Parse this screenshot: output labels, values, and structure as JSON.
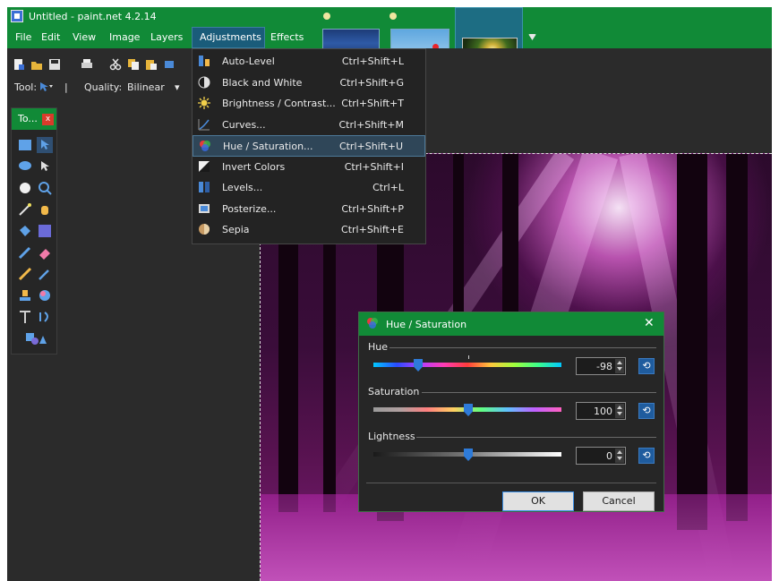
{
  "window": {
    "title": "Untitled - paint.net 4.2.14"
  },
  "menubar": {
    "items": [
      "File",
      "Edit",
      "View",
      "Image",
      "Layers",
      "Adjustments",
      "Effects"
    ],
    "active": "Adjustments"
  },
  "toolbar": {
    "tool_label": "Tool:",
    "quality_label": "Quality:",
    "quality_value": "Bilinear"
  },
  "tools_window": {
    "title": "To...",
    "close": "x"
  },
  "adjustments_menu": {
    "items": [
      {
        "label": "Auto-Level",
        "shortcut": "Ctrl+Shift+L",
        "icon": "auto-level-icon"
      },
      {
        "label": "Black and White",
        "shortcut": "Ctrl+Shift+G",
        "icon": "black-and-white-icon"
      },
      {
        "label": "Brightness / Contrast...",
        "shortcut": "Ctrl+Shift+T",
        "icon": "brightness-contrast-icon"
      },
      {
        "label": "Curves...",
        "shortcut": "Ctrl+Shift+M",
        "icon": "curves-icon"
      },
      {
        "label": "Hue / Saturation...",
        "shortcut": "Ctrl+Shift+U",
        "icon": "hue-saturation-icon"
      },
      {
        "label": "Invert Colors",
        "shortcut": "Ctrl+Shift+I",
        "icon": "invert-colors-icon"
      },
      {
        "label": "Levels...",
        "shortcut": "Ctrl+L",
        "icon": "levels-icon"
      },
      {
        "label": "Posterize...",
        "shortcut": "Ctrl+Shift+P",
        "icon": "posterize-icon"
      },
      {
        "label": "Sepia",
        "shortcut": "Ctrl+Shift+E",
        "icon": "sepia-icon"
      }
    ],
    "selected_index": 4
  },
  "dialog": {
    "title": "Hue / Saturation",
    "close": "✕",
    "hue": {
      "label": "Hue",
      "value": "-98",
      "reset": "⟲"
    },
    "saturation": {
      "label": "Saturation",
      "value": "100",
      "reset": "⟲"
    },
    "lightness": {
      "label": "Lightness",
      "value": "0",
      "reset": "⟲"
    },
    "ok": "OK",
    "cancel": "Cancel"
  },
  "colors": {
    "title_green": "#118a37",
    "accent_blue": "#2e7bd9",
    "menu_bg": "#232323"
  }
}
